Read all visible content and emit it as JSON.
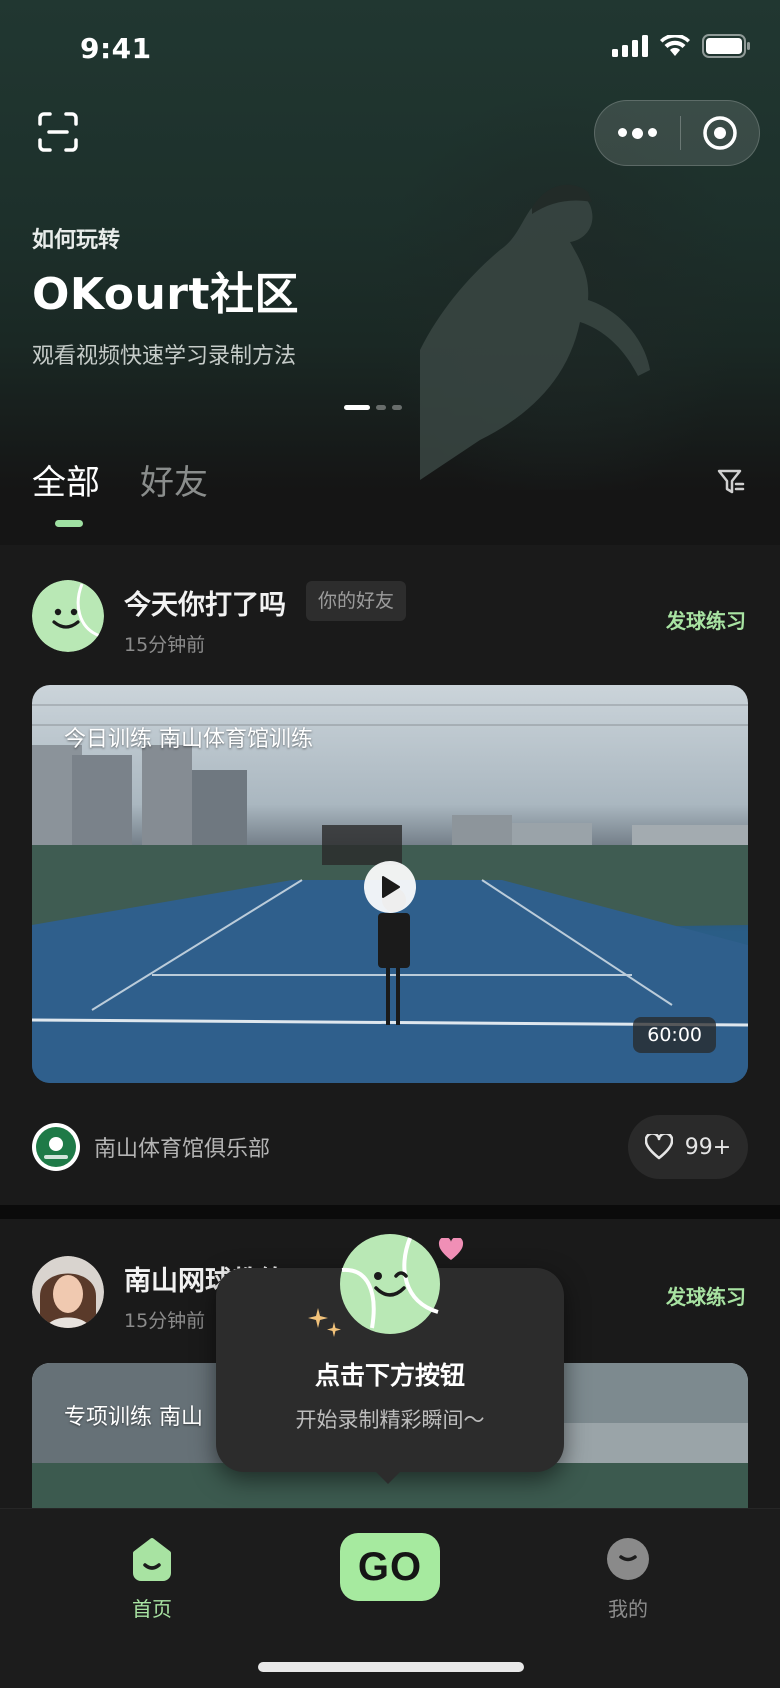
{
  "status": {
    "time": "9:41"
  },
  "hero": {
    "kicker": "如何玩转",
    "title": "OKourt社区",
    "subtitle": "观看视频快速学习录制方法"
  },
  "tabs": [
    {
      "label": "全部",
      "active": true
    },
    {
      "label": "好友",
      "active": false
    }
  ],
  "posts": [
    {
      "user": "今天你打了吗",
      "badge": "你的好友",
      "time": "15分钟前",
      "tag": "发球练习",
      "video_caption": "今日训练 南山体育馆训练",
      "duration": "60:00",
      "club": "南山体育馆俱乐部",
      "likes": "99+"
    },
    {
      "user": "南山网球教练",
      "time": "15分钟前",
      "tag": "发球练习",
      "video_caption": "专项训练  南山"
    }
  ],
  "tooltip": {
    "title": "点击下方按钮",
    "subtitle": "开始录制精彩瞬间～"
  },
  "nav": {
    "home": "首页",
    "go": "GO",
    "me": "我的"
  },
  "colors": {
    "accent": "#a6ea9f",
    "background": "#151515"
  }
}
